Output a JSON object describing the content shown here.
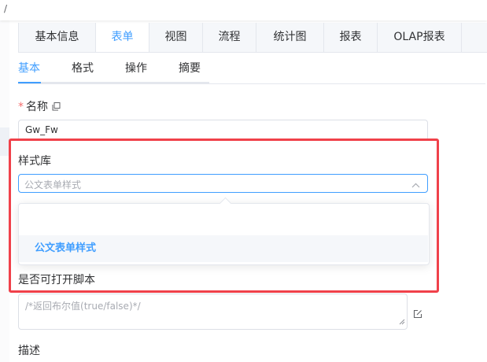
{
  "breadcrumb": {
    "separator": "/"
  },
  "main_tabs": [
    {
      "label": "基本信息",
      "active": false
    },
    {
      "label": "表单",
      "active": true
    },
    {
      "label": "视图",
      "active": false
    },
    {
      "label": "流程",
      "active": false
    },
    {
      "label": "统计图",
      "active": false
    },
    {
      "label": "报表",
      "active": false
    },
    {
      "label": "OLAP报表",
      "active": false
    }
  ],
  "sub_tabs": [
    {
      "label": "基本",
      "active": true
    },
    {
      "label": "格式",
      "active": false
    },
    {
      "label": "操作",
      "active": false
    },
    {
      "label": "摘要",
      "active": false
    }
  ],
  "form": {
    "name": {
      "required_mark": "*",
      "label": "名称",
      "value": "Gw_Fw"
    },
    "style_library": {
      "label": "样式库",
      "placeholder": "公文表单样式",
      "options": [
        "公文表单样式"
      ]
    },
    "script": {
      "label": "是否可打开脚本",
      "placeholder": "/*返回布尔值(true/false)*/"
    },
    "description": {
      "label": "描述"
    }
  },
  "icons": {
    "copy": "copy-icon",
    "chevron": "chevron-up-icon",
    "edit": "edit-icon",
    "resize": "resize-grip-icon"
  },
  "colors": {
    "accent": "#409eff",
    "required": "#f56c6c",
    "highlight": "#f0414a",
    "border": "#dcdfe6"
  }
}
